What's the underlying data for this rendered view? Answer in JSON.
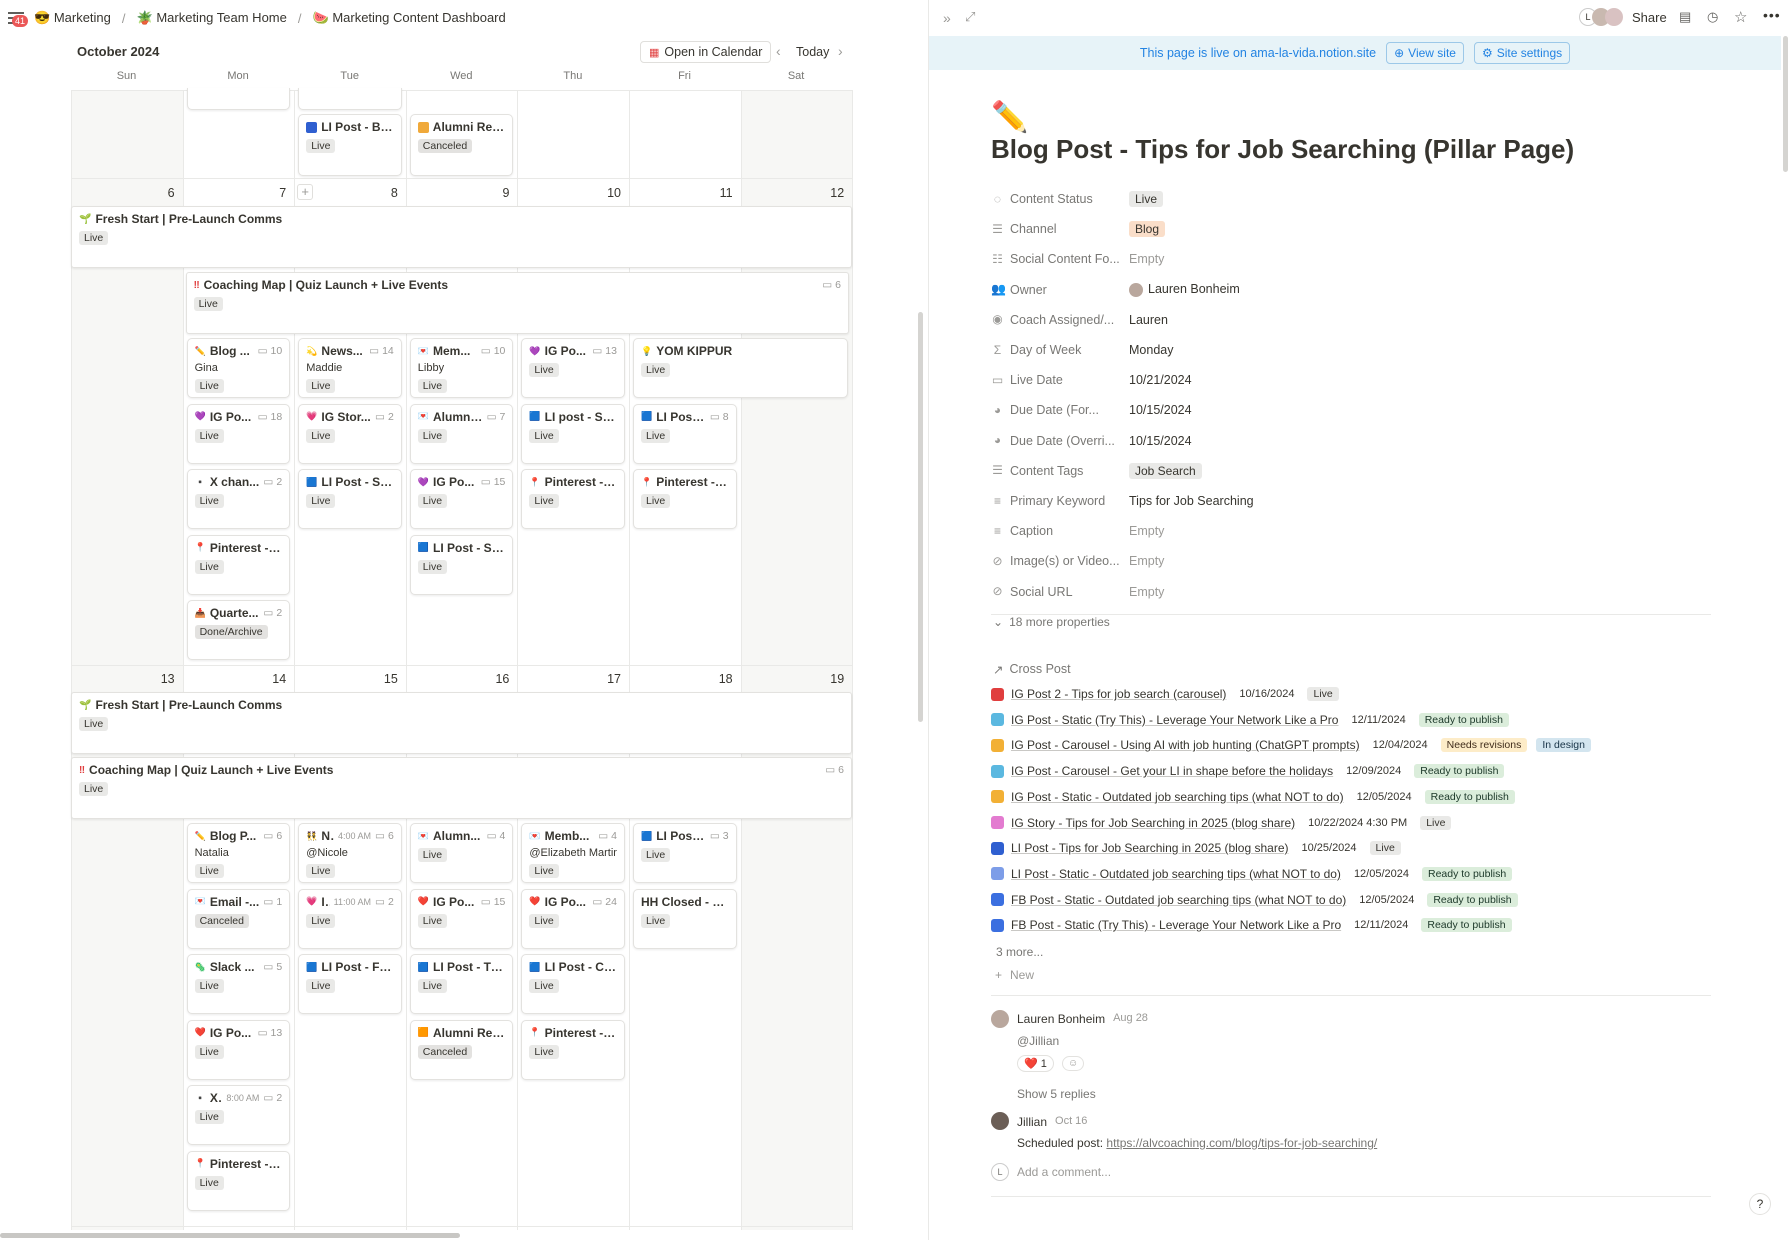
{
  "breadcrumb": {
    "badge": "41",
    "items": [
      {
        "emoji": "😎",
        "label": "Marketing"
      },
      {
        "emoji": "🪴",
        "label": "Marketing Team Home"
      },
      {
        "emoji": "🍉",
        "label": "Marketing Content Dashboard"
      }
    ]
  },
  "calendar": {
    "month": "October 2024",
    "open_label": "Open in Calendar",
    "today_label": "Today",
    "days": [
      "Sun",
      "Mon",
      "Tue",
      "Wed",
      "Thu",
      "Fri",
      "Sat"
    ],
    "week1_nums": [
      "6",
      "7",
      "8",
      "9",
      "10",
      "11",
      "12"
    ],
    "week2_nums": [
      "13",
      "14",
      "15",
      "16",
      "17",
      "18",
      "19"
    ],
    "top_cards": [
      {
        "title": "LI Post - Blo...",
        "tag": "Live",
        "color": "#2f5fd0"
      },
      {
        "title": "Alumni Refe...",
        "tag": "Canceled",
        "color": "#f0a93a"
      }
    ],
    "w1_banner1": {
      "title": "Fresh Start | Pre-Launch Comms",
      "tag": "Live"
    },
    "w1_banner2": {
      "title": "Coaching Map | Quiz Launch + Live Events",
      "tag": "Live",
      "count": "6"
    },
    "w1_cards": [
      {
        "title": "Blog ...",
        "count": "10",
        "sub": "Gina",
        "tag": "Live",
        "emoji": "✏️"
      },
      {
        "title": "News...",
        "count": "14",
        "sub": "Maddie",
        "tag": "Live",
        "emoji": "💫"
      },
      {
        "title": "Mem...",
        "count": "10",
        "sub": "Libby",
        "tag": "Live",
        "emoji": "💌"
      },
      {
        "title": "IG Po...",
        "count": "13",
        "tag": "Live",
        "emoji": "💜"
      },
      {
        "title": "YOM KIPPUR",
        "tag": "Live",
        "emoji": "💡"
      },
      {
        "title": "IG Po...",
        "count": "18",
        "tag": "Live",
        "emoji": "💜"
      },
      {
        "title": "IG Stor...",
        "count": "2",
        "tag": "Live",
        "emoji": "💗"
      },
      {
        "title": "Alumni...",
        "count": "7",
        "tag": "Live",
        "emoji": "💌"
      },
      {
        "title": "LI post - Sta...",
        "tag": "Live",
        "emoji": "🟦"
      },
      {
        "title": "LI Post...",
        "count": "8",
        "tag": "Live",
        "emoji": "🟦"
      },
      {
        "title": "X chan...",
        "count": "2",
        "tag": "Live",
        "emoji": "▪️"
      },
      {
        "title": "LI Post - Sta...",
        "tag": "Live",
        "emoji": "🟦"
      },
      {
        "title": "IG Po...",
        "count": "15",
        "tag": "Live",
        "emoji": "💜"
      },
      {
        "title": "Pinterest - S...",
        "tag": "Live",
        "emoji": "📍"
      },
      {
        "title": "Pinterest - J...",
        "tag": "Live",
        "emoji": "📍"
      },
      {
        "title": "Pinterest - (...",
        "tag": "Live",
        "emoji": "📍"
      },
      {
        "title": "LI Post - Sta...",
        "tag": "Live",
        "emoji": "🟦"
      },
      {
        "title": "Quarte...",
        "count": "2",
        "tag": "Done/Archive",
        "emoji": "📥"
      }
    ],
    "w2_banner1": {
      "title": "Fresh Start | Pre-Launch Comms",
      "tag": "Live"
    },
    "w2_banner2": {
      "title": "Coaching Map | Quiz Launch + Live Events",
      "tag": "Live",
      "count": "6"
    },
    "w2_cards": [
      {
        "title": "Blog P...",
        "count": "6",
        "sub": "Natalia",
        "tag": "Live",
        "emoji": "✏️"
      },
      {
        "title": "N...",
        "time": "4:00 AM",
        "count": "6",
        "sub": "@Nicole",
        "tag": "Live",
        "emoji": "👯"
      },
      {
        "title": "Alumn...",
        "count": "4",
        "tag": "Live",
        "emoji": "💌"
      },
      {
        "title": "Memb...",
        "count": "4",
        "sub": "@Elizabeth Martinez",
        "tag": "Live",
        "emoji": "💌"
      },
      {
        "title": "LI Post...",
        "count": "3",
        "tag": "Live",
        "emoji": "🟦"
      },
      {
        "title": "Email -...",
        "count": "1",
        "tag": "Canceled",
        "emoji": "💌"
      },
      {
        "title": "I...",
        "time": "11:00 AM",
        "count": "2",
        "tag": "Live",
        "emoji": "💗"
      },
      {
        "title": "IG Po...",
        "count": "15",
        "tag": "Live",
        "emoji": "❤️"
      },
      {
        "title": "IG Po...",
        "count": "24",
        "tag": "Live",
        "emoji": "❤️"
      },
      {
        "title": "HH Closed - M...",
        "tag": "Live",
        "emoji": ""
      },
      {
        "title": "Slack ...",
        "count": "5",
        "tag": "Live",
        "emoji": "🦠"
      },
      {
        "title": "LI Post - Fee...",
        "tag": "Live",
        "emoji": "🟦"
      },
      {
        "title": "LI Post - Tip...",
        "tag": "Live",
        "emoji": "🟦"
      },
      {
        "title": "LI Post - Cre...",
        "tag": "Live",
        "emoji": "🟦"
      },
      {
        "title": "IG Po...",
        "count": "13",
        "tag": "Live",
        "emoji": "❤️"
      },
      {
        "title": "Alumni Refe...",
        "tag": "Canceled",
        "emoji": "🟧"
      },
      {
        "title": "Pinterest - C...",
        "tag": "Live",
        "emoji": "📍"
      },
      {
        "title": "X...",
        "time": "8:00 AM",
        "count": "2",
        "tag": "Live",
        "emoji": "▪️"
      },
      {
        "title": "Pinterest - F...",
        "tag": "Live",
        "emoji": "📍"
      }
    ]
  },
  "panel": {
    "share": "Share",
    "banner": {
      "text": "This page is live on ama-la-vida.notion.site",
      "view": "View site",
      "settings": "Site settings"
    },
    "emoji": "✏️",
    "title": "Blog Post - Tips for Job Searching (Pillar Page)",
    "properties": [
      {
        "icon": "◌",
        "key": "Content Status",
        "value": "Live",
        "style": "tag"
      },
      {
        "icon": "☰",
        "key": "Channel",
        "value": "Blog",
        "style": "tag-orange"
      },
      {
        "icon": "☷",
        "key": "Social Content Fo...",
        "value": "Empty",
        "style": "empty"
      },
      {
        "icon": "👥",
        "key": "Owner",
        "value": "Lauren Bonheim",
        "style": "person"
      },
      {
        "icon": "◉",
        "key": "Coach Assigned/...",
        "value": "Lauren",
        "style": "text"
      },
      {
        "icon": "Σ",
        "key": "Day of Week",
        "value": "Monday",
        "style": "text"
      },
      {
        "icon": "▭",
        "key": "Live Date",
        "value": "10/21/2024",
        "style": "text"
      },
      {
        "icon": "◕",
        "key": "Due Date (For...",
        "value": "10/15/2024",
        "style": "text"
      },
      {
        "icon": "◕",
        "key": "Due Date (Overri...",
        "value": "10/15/2024",
        "style": "text"
      },
      {
        "icon": "☰",
        "key": "Content Tags",
        "value": "Job Search",
        "style": "tag"
      },
      {
        "icon": "≡",
        "key": "Primary Keyword",
        "value": "Tips for Job Searching",
        "style": "text"
      },
      {
        "icon": "≡",
        "key": "Caption",
        "value": "Empty",
        "style": "empty"
      },
      {
        "icon": "⊘",
        "key": "Image(s) or Video...",
        "value": "Empty",
        "style": "empty"
      },
      {
        "icon": "⊘",
        "key": "Social URL",
        "value": "Empty",
        "style": "empty"
      }
    ],
    "more_props": "18 more properties",
    "cross_post_label": "Cross Post",
    "cross_posts": [
      {
        "title": "IG Post 2 - Tips for job search (carousel)",
        "date": "10/16/2024",
        "status": [
          "Live"
        ],
        "color": "#e03e3e"
      },
      {
        "title": "IG Post - Static (Try This) - Leverage Your Network Like a Pro",
        "date": "12/11/2024",
        "status": [
          "Ready to publish"
        ],
        "color": "#5bb8e0"
      },
      {
        "title": "IG Post - Carousel - Using AI with job hunting (ChatGPT prompts)",
        "date": "12/04/2024",
        "status": [
          "Needs revisions",
          "In design"
        ],
        "color": "#f2b035"
      },
      {
        "title": "IG Post - Carousel - Get your LI in shape before the holidays",
        "date": "12/09/2024",
        "status": [
          "Ready to publish"
        ],
        "color": "#5bb8e0"
      },
      {
        "title": "IG Post - Static - Outdated job searching tips (what NOT to do)",
        "date": "12/05/2024",
        "status": [
          "Ready to publish"
        ],
        "color": "#f2b035"
      },
      {
        "title": "IG Story - Tips for Job Searching in 2025 (blog share)",
        "date": "10/22/2024 4:30 PM",
        "status": [
          "Live"
        ],
        "color": "#e37bd0"
      },
      {
        "title": "LI Post - Tips for Job Searching in 2025 (blog share)",
        "date": "10/25/2024",
        "status": [
          "Live"
        ],
        "color": "#2f5fd0"
      },
      {
        "title": "LI Post - Static - Outdated job searching tips (what NOT to do)",
        "date": "12/05/2024",
        "status": [
          "Ready to publish"
        ],
        "color": "#7d9de8"
      },
      {
        "title": "FB Post - Static - Outdated job searching tips (what NOT to do)",
        "date": "12/05/2024",
        "status": [
          "Ready to publish"
        ],
        "color": "#3b6fe0"
      },
      {
        "title": "FB Post - Static (Try This) - Leverage Your Network Like a Pro",
        "date": "12/11/2024",
        "status": [
          "Ready to publish"
        ],
        "color": "#3b6fe0"
      }
    ],
    "more_rows": "3 more...",
    "new_label": "New",
    "comments": [
      {
        "author": "Lauren Bonheim",
        "date": "Aug 28",
        "text": "@Jillian",
        "reaction": "❤️ 1",
        "replies": "Show 5 replies"
      },
      {
        "author": "Jillian",
        "date": "Oct 16",
        "prefix": "Scheduled post: ",
        "link": "https://alvcoaching.com/blog/tips-for-job-searching/"
      }
    ],
    "add_comment": "Add a comment..."
  }
}
